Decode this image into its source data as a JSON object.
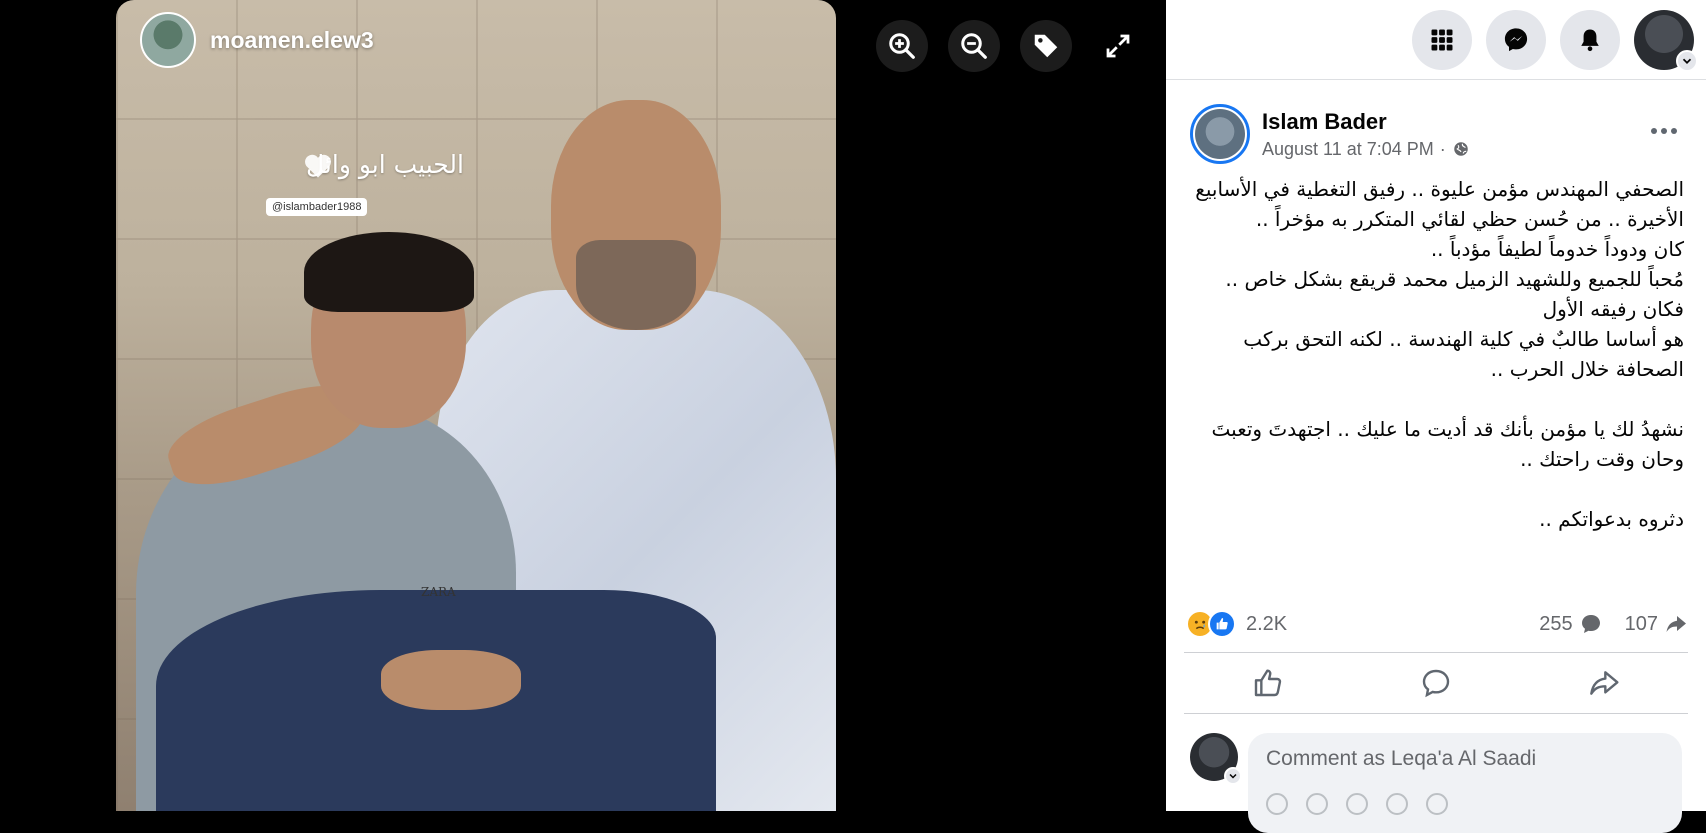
{
  "photo": {
    "username": "moamen.elew3",
    "caption": "الحبيب ابو وائل",
    "watermark": "@islambader1988",
    "shirt_brand": "ZARA"
  },
  "viewer_tools": [
    {
      "icon": "zoom-in-icon"
    },
    {
      "icon": "zoom-out-icon"
    },
    {
      "icon": "tag-icon"
    },
    {
      "icon": "fullscreen-icon"
    }
  ],
  "topbar": {
    "icons": [
      "menu-grid-icon",
      "messenger-icon",
      "notifications-icon"
    ]
  },
  "post": {
    "author": "Islam Bader",
    "timestamp": "August 11 at 7:04 PM",
    "separator": "·",
    "text": "الصحفي المهندس مؤمن عليوة .. رفيق التغطية في الأسابيع الأخيرة .. من حُسن حظي لقائي المتكرر به مؤخراً ..\nكان ودوداً خدوماً لطيفاً مؤدباً ..\nمُحباً للجميع وللشهيد الزميل محمد قريقع بشكل خاص .. فكان رفيقه الأول\nهو أساسا طالبٌ في كلية الهندسة .. لكنه التحق بركب الصحافة خلال الحرب ..\n\nنشهدُ لك يا مؤمن بأنك قد أديت ما عليك .. اجتهدتَ وتعبتَ وحان وقت راحتك ..\n\nدثروه بدعواتكم ..",
    "reactions_count": "2.2K",
    "comments_count": "255",
    "shares_count": "107"
  },
  "comment": {
    "placeholder": "Comment as Leqa'a Al Saadi"
  },
  "colors": {
    "accent": "#1877f2",
    "text": "#050505",
    "secondary": "#65676b"
  }
}
